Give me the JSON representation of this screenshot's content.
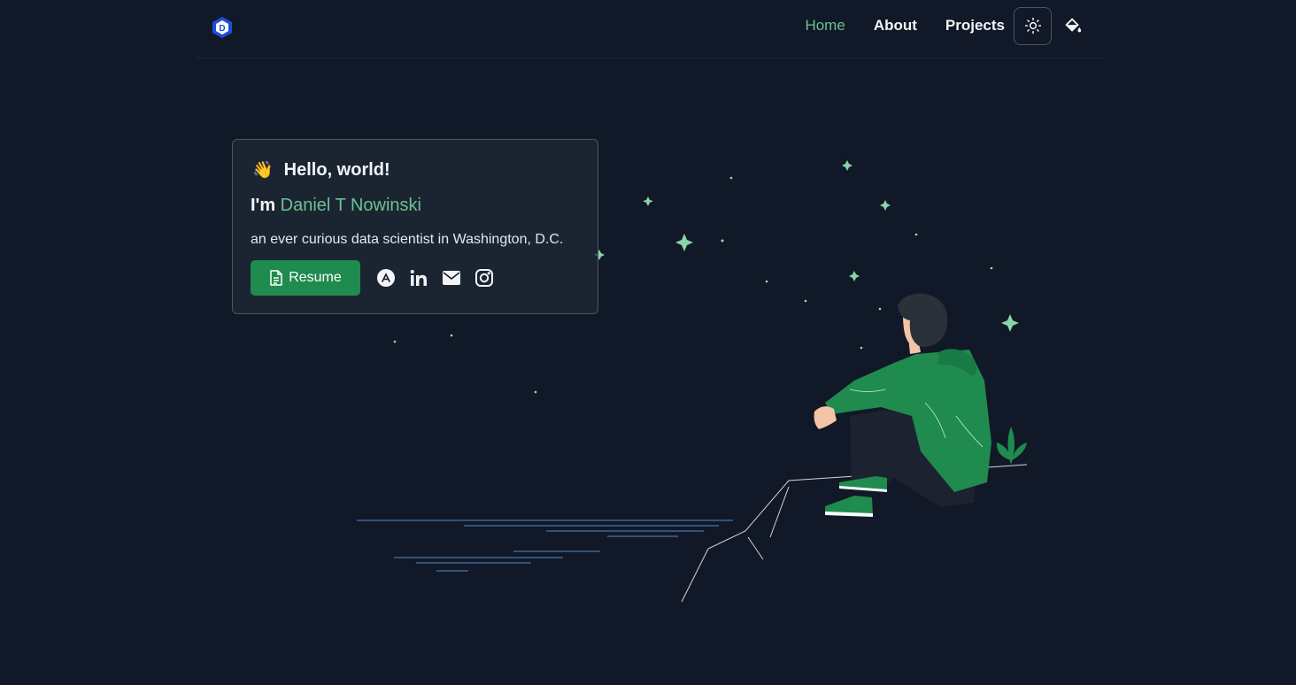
{
  "nav": {
    "logo_letter": "D",
    "links": [
      {
        "label": "Home",
        "active": true
      },
      {
        "label": "About",
        "active": false
      },
      {
        "label": "Projects",
        "active": false
      }
    ],
    "theme_icon": "sun-icon",
    "paint_icon": "paint-bucket-icon"
  },
  "hero": {
    "wave_emoji": "👋",
    "greeting": "Hello, world!",
    "intro_prefix": "I'm",
    "name": "Daniel T Nowinski",
    "tagline": "an ever curious data scientist in Washington, D.C.",
    "resume_label": "Resume",
    "social_icons": [
      "app-store-icon",
      "linkedin-icon",
      "email-icon",
      "instagram-icon"
    ]
  },
  "colors": {
    "background": "#111827",
    "accent": "#6cc191",
    "button": "#1f8b4f",
    "logo": "#1d4ed8"
  }
}
